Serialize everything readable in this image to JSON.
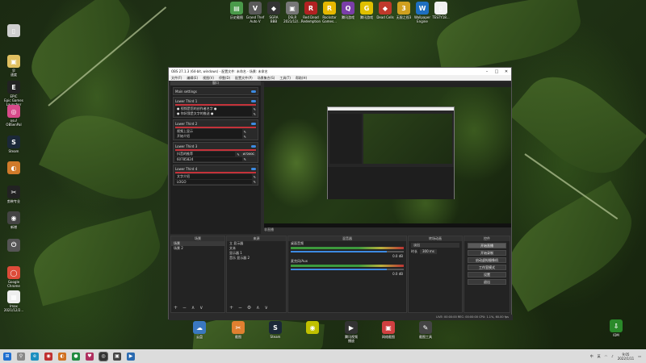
{
  "desktop": {
    "left_icons": [
      {
        "label": "",
        "color": "#cfcfcf",
        "glyph": "▯"
      },
      {
        "label": "早\n速度",
        "color": "#e0c060",
        "glyph": "▣"
      },
      {
        "label": "EPIC\nEpic Games\nLauncher",
        "color": "#222222",
        "glyph": "E"
      },
      {
        "label": "osu!\nOBSenPal",
        "color": "#d84a8a",
        "glyph": "◎"
      },
      {
        "label": "Steam",
        "color": "#1b2838",
        "glyph": "S"
      },
      {
        "label": "",
        "color": "#d07a2a",
        "glyph": "◐"
      },
      {
        "label": "剪映专业",
        "color": "#222222",
        "glyph": "✂"
      },
      {
        "label": "新增",
        "color": "#444444",
        "glyph": "◉"
      },
      {
        "label": "",
        "color": "#555555",
        "glyph": "⏻"
      },
      {
        "label": "Google\nChrome",
        "color": "#dd4b39",
        "glyph": "◯"
      },
      {
        "label": "Imax\n2021/12/2...",
        "color": "#eeeeee",
        "glyph": "▦"
      }
    ],
    "top_icons": [
      {
        "label": "历史截图",
        "color": "#4a9a4a",
        "glyph": "▤"
      },
      {
        "label": "Grand Thef\nAuto V",
        "color": "#5a5a5a",
        "glyph": "V"
      },
      {
        "label": "SGRA\nBBB",
        "color": "#333333",
        "glyph": "◆"
      },
      {
        "label": "DSLR\n2021/12/...",
        "color": "#777777",
        "glyph": "▣"
      },
      {
        "label": "Red Dead\nRedemption",
        "color": "#b22222",
        "glyph": "R"
      },
      {
        "label": "Rockstar\nGames...",
        "color": "#e6b800",
        "glyph": "R"
      },
      {
        "label": "腾讯游戏",
        "color": "#7a3ea8",
        "glyph": "Q"
      },
      {
        "label": "腾讯游戏",
        "color": "#e0c000",
        "glyph": "G"
      },
      {
        "label": "Dead Cells",
        "color": "#c0392b",
        "glyph": "◆"
      },
      {
        "label": "无限之视3",
        "color": "#d0a020",
        "glyph": "3"
      },
      {
        "label": "Wallpaper\nEngine",
        "color": "#1e6fc0",
        "glyph": "W"
      },
      {
        "label": "TESTY18...",
        "color": "#f0f0f0",
        "glyph": "▯"
      }
    ],
    "bottom_icons": [
      {
        "label": "云盘",
        "color": "#3a78c0",
        "glyph": "☁"
      },
      {
        "label": "截图",
        "color": "#e08030",
        "glyph": "✂"
      },
      {
        "label": "Steam",
        "color": "#1b2838",
        "glyph": "S"
      },
      {
        "label": "",
        "color": "#c0c000",
        "glyph": "◉"
      },
      {
        "label": "腾讯视频\n播放",
        "color": "#333333",
        "glyph": "▶"
      },
      {
        "label": "网络截图",
        "color": "#d04040",
        "glyph": "▣"
      },
      {
        "label": "截图工具",
        "color": "#444444",
        "glyph": "✎"
      }
    ],
    "right_icon": {
      "label": "IDM",
      "color": "#2a8a2a",
      "glyph": "⇩"
    }
  },
  "obs": {
    "title": "OBS 27.1.3 (64-bit, windows) - 配置文件: 未命名 - 场景: 未命名",
    "menu": [
      "文件(F)",
      "编辑(E)",
      "视图(V)",
      "停靠(D)",
      "配置文件(P)",
      "场景集合(S)",
      "工具(T)",
      "帮助(H)"
    ],
    "dock_header": "窗口",
    "dock_lower_thirds": [
      {
        "title": "Main settings",
        "items": []
      },
      {
        "title": "Lower Third 1",
        "items": [
          {
            "text": "● 视频是您的创作者名字 ●",
            "badge": "",
            "badge_color": ""
          },
          {
            "text": "● 你好我是文字的推送 ●",
            "badge": "",
            "badge_color": ""
          }
        ]
      },
      {
        "title": "Lower Third 2",
        "items": [
          {
            "text": "视频上显示",
            "badge": "",
            "badge_color": "#d85a1a"
          },
          {
            "text": "开始介绍",
            "badge": "",
            "badge_color": "#d8a01a"
          }
        ]
      },
      {
        "title": "Lower Third 3",
        "items": [
          {
            "text": "抖音的推荐",
            "badge": "#7200C",
            "badge_color": "#333333"
          },
          {
            "text": "60785824",
            "badge": "",
            "badge_color": "#d8a01a"
          }
        ]
      },
      {
        "title": "Lower Third 4",
        "items": [
          {
            "text": "文字介绍",
            "badge": "",
            "badge_color": ""
          },
          {
            "text": "LOGO",
            "badge": "",
            "badge_color": ""
          }
        ]
      }
    ],
    "preview_label": "非直播",
    "panels": {
      "scenes": {
        "header": "场景",
        "items": [
          "场景",
          "场景 2"
        ]
      },
      "sources": {
        "header": "来源",
        "items": [
          "立 显示器",
          "文本",
          "显示器 1",
          "音乐 显示器 2"
        ]
      },
      "mixer": {
        "header": "混音器",
        "channels": [
          {
            "name": "桌面音频",
            "db": "0.0 dB"
          },
          {
            "name": "麦克风/Aux",
            "db": "0.0 dB"
          }
        ]
      },
      "transitions": {
        "header": "转场动画",
        "type": "淡出",
        "duration_label": "时长",
        "duration": "300 ms"
      },
      "controls": {
        "header": "控件",
        "buttons": [
          "开始直播",
          "开始录制",
          "启动虚拟摄像机",
          "工作室模式",
          "设置",
          "退出"
        ]
      }
    },
    "status": "LIVE: 00:00:00    REC: 00:00:00    CPU: 1.1%, 60.00 fps"
  },
  "taskbar": {
    "time": "9:05",
    "date": "2022/1/11",
    "tray_items": [
      "中",
      "英"
    ]
  }
}
